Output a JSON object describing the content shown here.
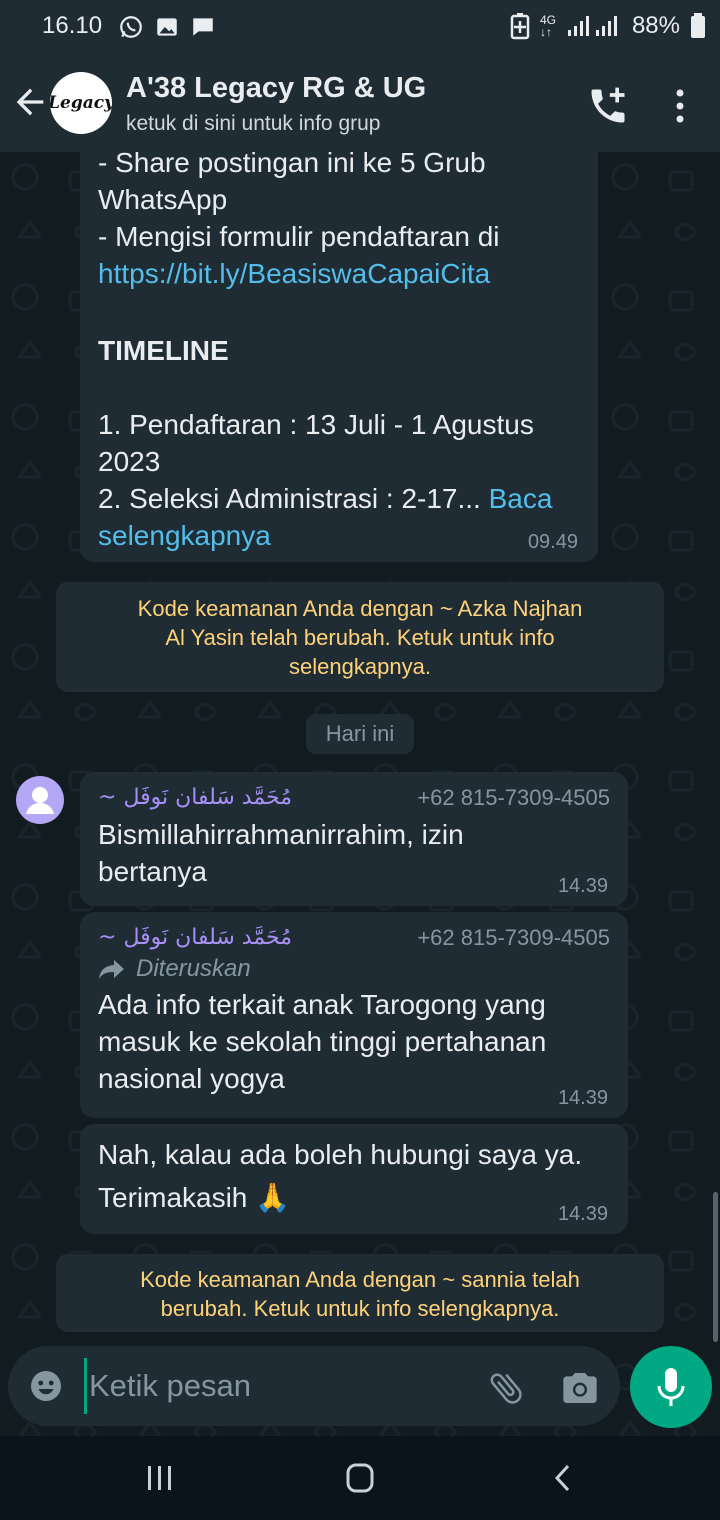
{
  "status_bar": {
    "time": "16.10",
    "battery": "88%",
    "network": "4G"
  },
  "header": {
    "title": "A'38 Legacy RG & UG",
    "subtitle": "ketuk di sini untuk info grup",
    "avatar_text": "Legacy"
  },
  "messages": {
    "m1": {
      "line1": "- Share postingan ini ke 5 Grub",
      "line2": "WhatsApp",
      "line3": "- Mengisi formulir pendaftaran di",
      "link": "https://bit.ly/BeasiswaCapaiCita",
      "heading": "TIMELINE",
      "line4": "1. Pendaftaran : 13 Juli - 1 Agustus",
      "line5": "2023",
      "line6": "2. Seleksi Administrasi : 2-17...",
      "read_more_1": "Baca",
      "read_more_2": "selengkapnya",
      "time": "09.49"
    },
    "sys1": {
      "line1": "Kode keamanan Anda dengan ~ Azka Najhan",
      "line2": "Al Yasin telah berubah. Ketuk untuk info",
      "line3": "selengkapnya."
    },
    "date_chip": "Hari ini",
    "m2": {
      "sender": "~ مُحَمَّد سَلفان نَوفَل",
      "phone": "+62 815-7309-4505",
      "line1": "Bismillahirrahmanirrahim, izin",
      "line2": "bertanya",
      "time": "14.39"
    },
    "m3": {
      "sender": "~ مُحَمَّد سَلفان نَوفَل",
      "phone": "+62 815-7309-4505",
      "forwarded": "Diteruskan",
      "line1": "Ada info terkait anak Tarogong yang",
      "line2": "masuk ke sekolah tinggi pertahanan",
      "line3": "nasional yogya",
      "time": "14.39"
    },
    "m4": {
      "line1": "Nah, kalau ada boleh hubungi saya ya.",
      "line2": "Terimakasih",
      "emoji": "🙏",
      "time": "14.39"
    },
    "sys2": {
      "line1": "Kode keamanan Anda dengan ~ sannia telah",
      "line2": "berubah. Ketuk untuk info selengkapnya."
    }
  },
  "input": {
    "placeholder": "Ketik pesan"
  },
  "colors": {
    "header_bg": "#1f2c34",
    "chat_bg": "#121b20",
    "bubble_bg": "#1f2c34",
    "accent": "#00a884",
    "link": "#53bdeb",
    "system_text": "#ffd279",
    "sender_name": "#a791f9"
  },
  "icons": [
    "whatsapp-icon",
    "gallery-icon",
    "chat-icon",
    "battery-saver-icon",
    "signal-icon",
    "battery-icon",
    "back-arrow-icon",
    "add-call-icon",
    "more-vert-icon",
    "user-avatar-icon",
    "forward-icon",
    "emoji-icon",
    "attach-icon",
    "camera-icon",
    "mic-icon",
    "recents-icon",
    "home-icon",
    "back-icon"
  ]
}
